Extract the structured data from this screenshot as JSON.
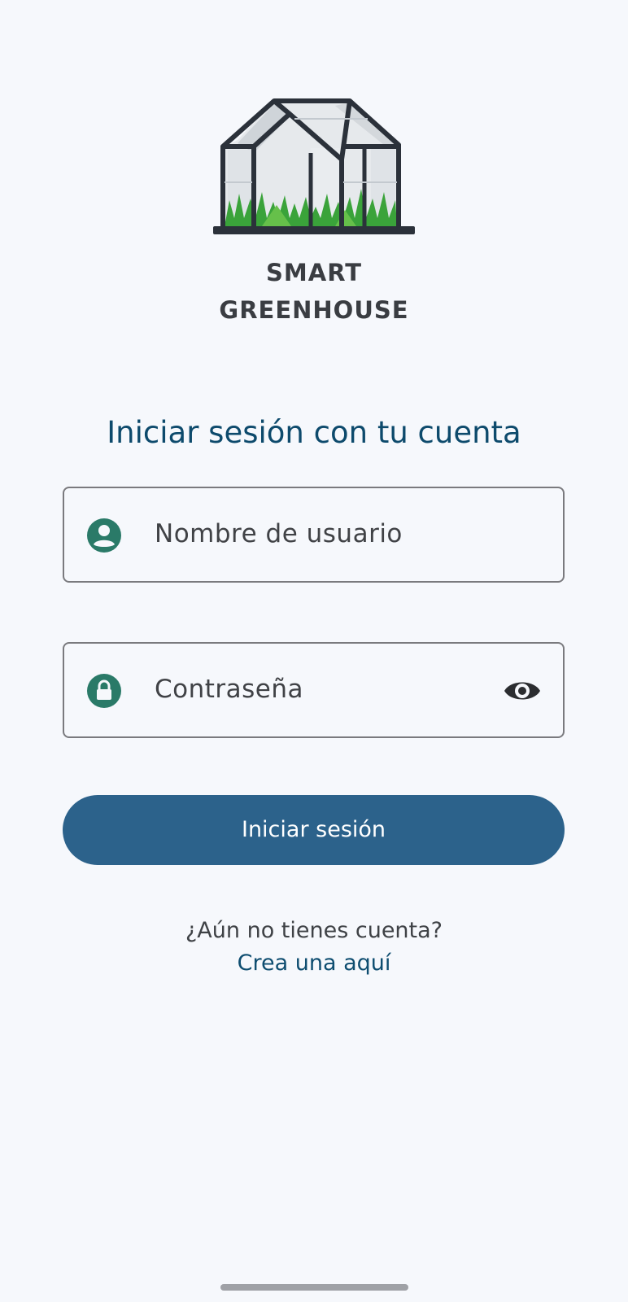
{
  "brand": {
    "line1": "SMART",
    "line2": "GREENHOUSE"
  },
  "title": "Iniciar sesión con tu cuenta",
  "form": {
    "username": {
      "placeholder": "Nombre de usuario",
      "icon": "account-circle-icon"
    },
    "password": {
      "placeholder": "Contraseña",
      "icon": "lock-icon",
      "toggle_icon": "eye-icon"
    }
  },
  "login_button": "Iniciar sesión",
  "signup": {
    "prompt": "¿Aún no tienes cuenta?",
    "link": "Crea una aquí"
  },
  "colors": {
    "background": "#f6f8fc",
    "title": "#0d4a6c",
    "primary": "#2c628b",
    "icon_accent": "#2a7a68",
    "link": "#0e4d70"
  }
}
